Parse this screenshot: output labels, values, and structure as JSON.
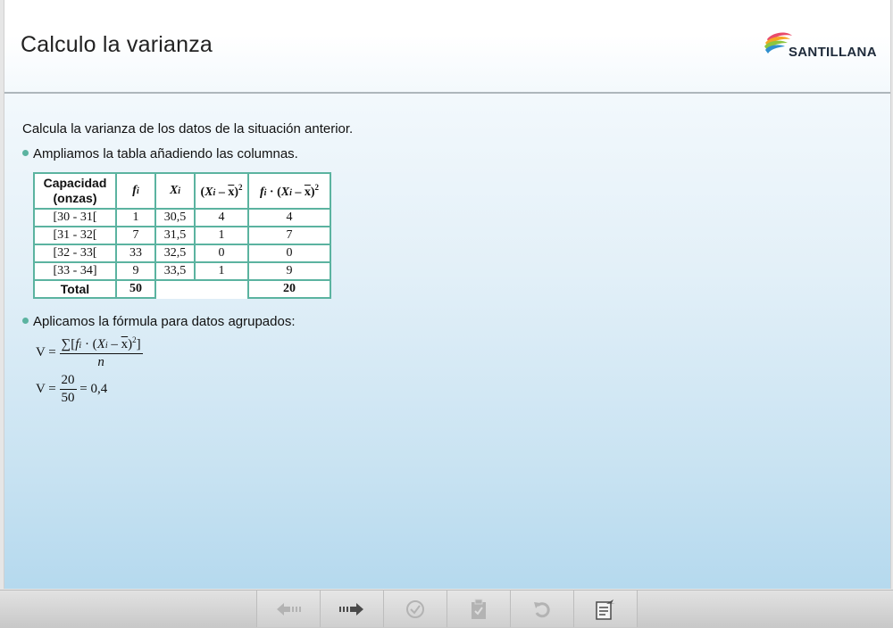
{
  "header": {
    "title": "Calculo la varianza",
    "logo_text": "SANTILLANA"
  },
  "content": {
    "intro": "Calcula la varianza de los datos de la situación anterior.",
    "bullet1": "Ampliamos la tabla añadiendo las columnas.",
    "bullet2": "Aplicamos la fórmula para datos agrupados:"
  },
  "table": {
    "header_capacidad": "Capacidad (onzas)",
    "rows": [
      {
        "interval": "[30 - 31[",
        "fi": "1",
        "xi": "30,5",
        "dev": "4",
        "prod": "4"
      },
      {
        "interval": "[31 - 32[",
        "fi": "7",
        "xi": "31,5",
        "dev": "1",
        "prod": "7"
      },
      {
        "interval": "[32 - 33[",
        "fi": "33",
        "xi": "32,5",
        "dev": "0",
        "prod": "0"
      },
      {
        "interval": "[33 - 34]",
        "fi": "9",
        "xi": "33,5",
        "dev": "1",
        "prod": "9"
      }
    ],
    "total_label": "Total",
    "total_fi": "50",
    "total_prod": "20"
  },
  "formula": {
    "v_label": "V =",
    "num2": "20",
    "den2": "50",
    "result": "= 0,4"
  },
  "footer": {
    "buttons": [
      "back-arrow-icon",
      "forward-arrow-icon",
      "check-icon",
      "clipboard-icon",
      "undo-icon",
      "notes-icon"
    ]
  },
  "colors": {
    "accent": "#5bb3a0",
    "title": "#222222"
  }
}
